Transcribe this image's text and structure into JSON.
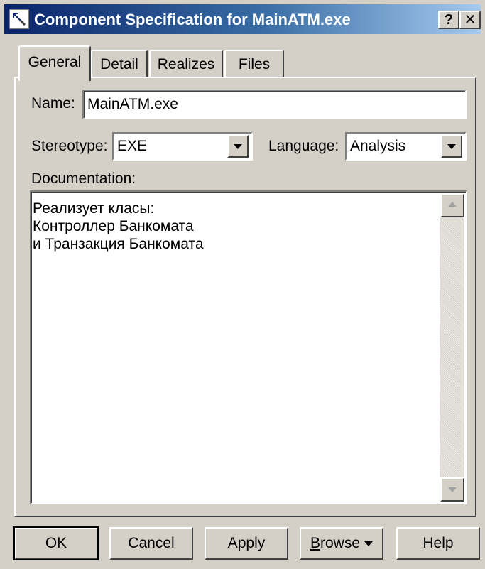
{
  "window": {
    "title": "Component Specification for MainATM.exe",
    "help_button": "?",
    "close_button": "✕"
  },
  "tabs": [
    {
      "label": "General"
    },
    {
      "label": "Detail"
    },
    {
      "label": "Realizes"
    },
    {
      "label": "Files"
    }
  ],
  "form": {
    "name_label": "Name:",
    "name_value": "MainATM.exe",
    "stereotype_label": "Stereotype:",
    "stereotype_value": "EXE",
    "language_label": "Language:",
    "language_value": "Analysis",
    "documentation_label": "Documentation:",
    "documentation_lines": [
      "Реализует класы:",
      "Контроллер Банкомата",
      "и Транзакция Банкомата"
    ]
  },
  "buttons": {
    "ok": "OK",
    "cancel": "Cancel",
    "apply": "Apply",
    "browse_first": "B",
    "browse_rest": "rowse",
    "help": "Help"
  },
  "colors": {
    "dialog_bg": "#d4d0c8",
    "title_gradient_start": "#0a246a",
    "title_gradient_end": "#a6caf0"
  }
}
